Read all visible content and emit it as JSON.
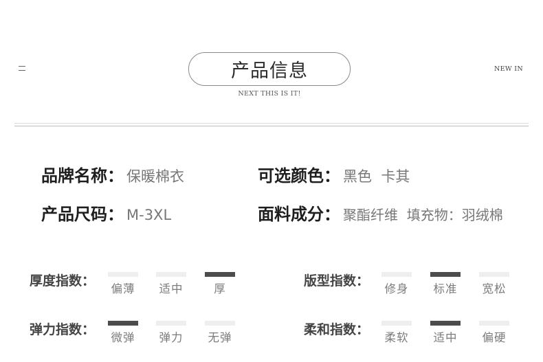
{
  "header": {
    "title": "产品信息",
    "subtitle": "NEXT THIS IS IT!",
    "new_in": "NEW IN"
  },
  "info": {
    "brand_name_label": "品牌名称：",
    "brand_name_value": "保暖棉衣",
    "color_label": "可选颜色：",
    "color_value": "黑色  卡其",
    "size_label": "产品尺码：",
    "size_value": "M-3XL",
    "material_label": "面料成分：",
    "material_value": "聚酯纤维  填充物：羽绒棉"
  },
  "indices": {
    "thickness": {
      "label": "厚度指数：",
      "options": [
        "偏薄",
        "适中",
        "厚"
      ],
      "selected": 2
    },
    "fit": {
      "label": "版型指数：",
      "options": [
        "修身",
        "标准",
        "宽松"
      ],
      "selected": 1
    },
    "elasticity": {
      "label": "弹力指数：",
      "options": [
        "微弹",
        "弹力",
        "无弹"
      ],
      "selected": 0
    },
    "softness": {
      "label": "柔和指数：",
      "options": [
        "柔软",
        "适中",
        "偏硬"
      ],
      "selected": 1
    }
  },
  "colors": {
    "bar_active": "#4c4c4c",
    "bar_inactive": "#eeeeee"
  }
}
